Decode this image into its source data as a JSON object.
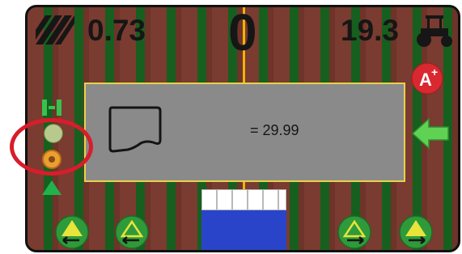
{
  "screen": {
    "off_line_value": "0.73",
    "cross_track_value": "0",
    "speed_value": "19.3"
  },
  "dialog": {
    "area_text": "= 29.99"
  },
  "icons": {
    "swath": "swath-hatch-icon",
    "vehicle": "tractor-icon",
    "a_plus": "a-plus-marker-icon",
    "align": "align-guidance-icon",
    "boundary": "boundary-shape-icon",
    "back": "green-back-arrow-icon",
    "nudge": "nudge-arrow-icon"
  },
  "colors": {
    "guide_line": "#f2b400",
    "dialog_background": "#8a8a8a",
    "dialog_border": "#e6d34a",
    "highlight_ring": "#d81d2a",
    "lightbar_active": "#2a44c9",
    "nudge_arrow": "#e7e43a"
  }
}
